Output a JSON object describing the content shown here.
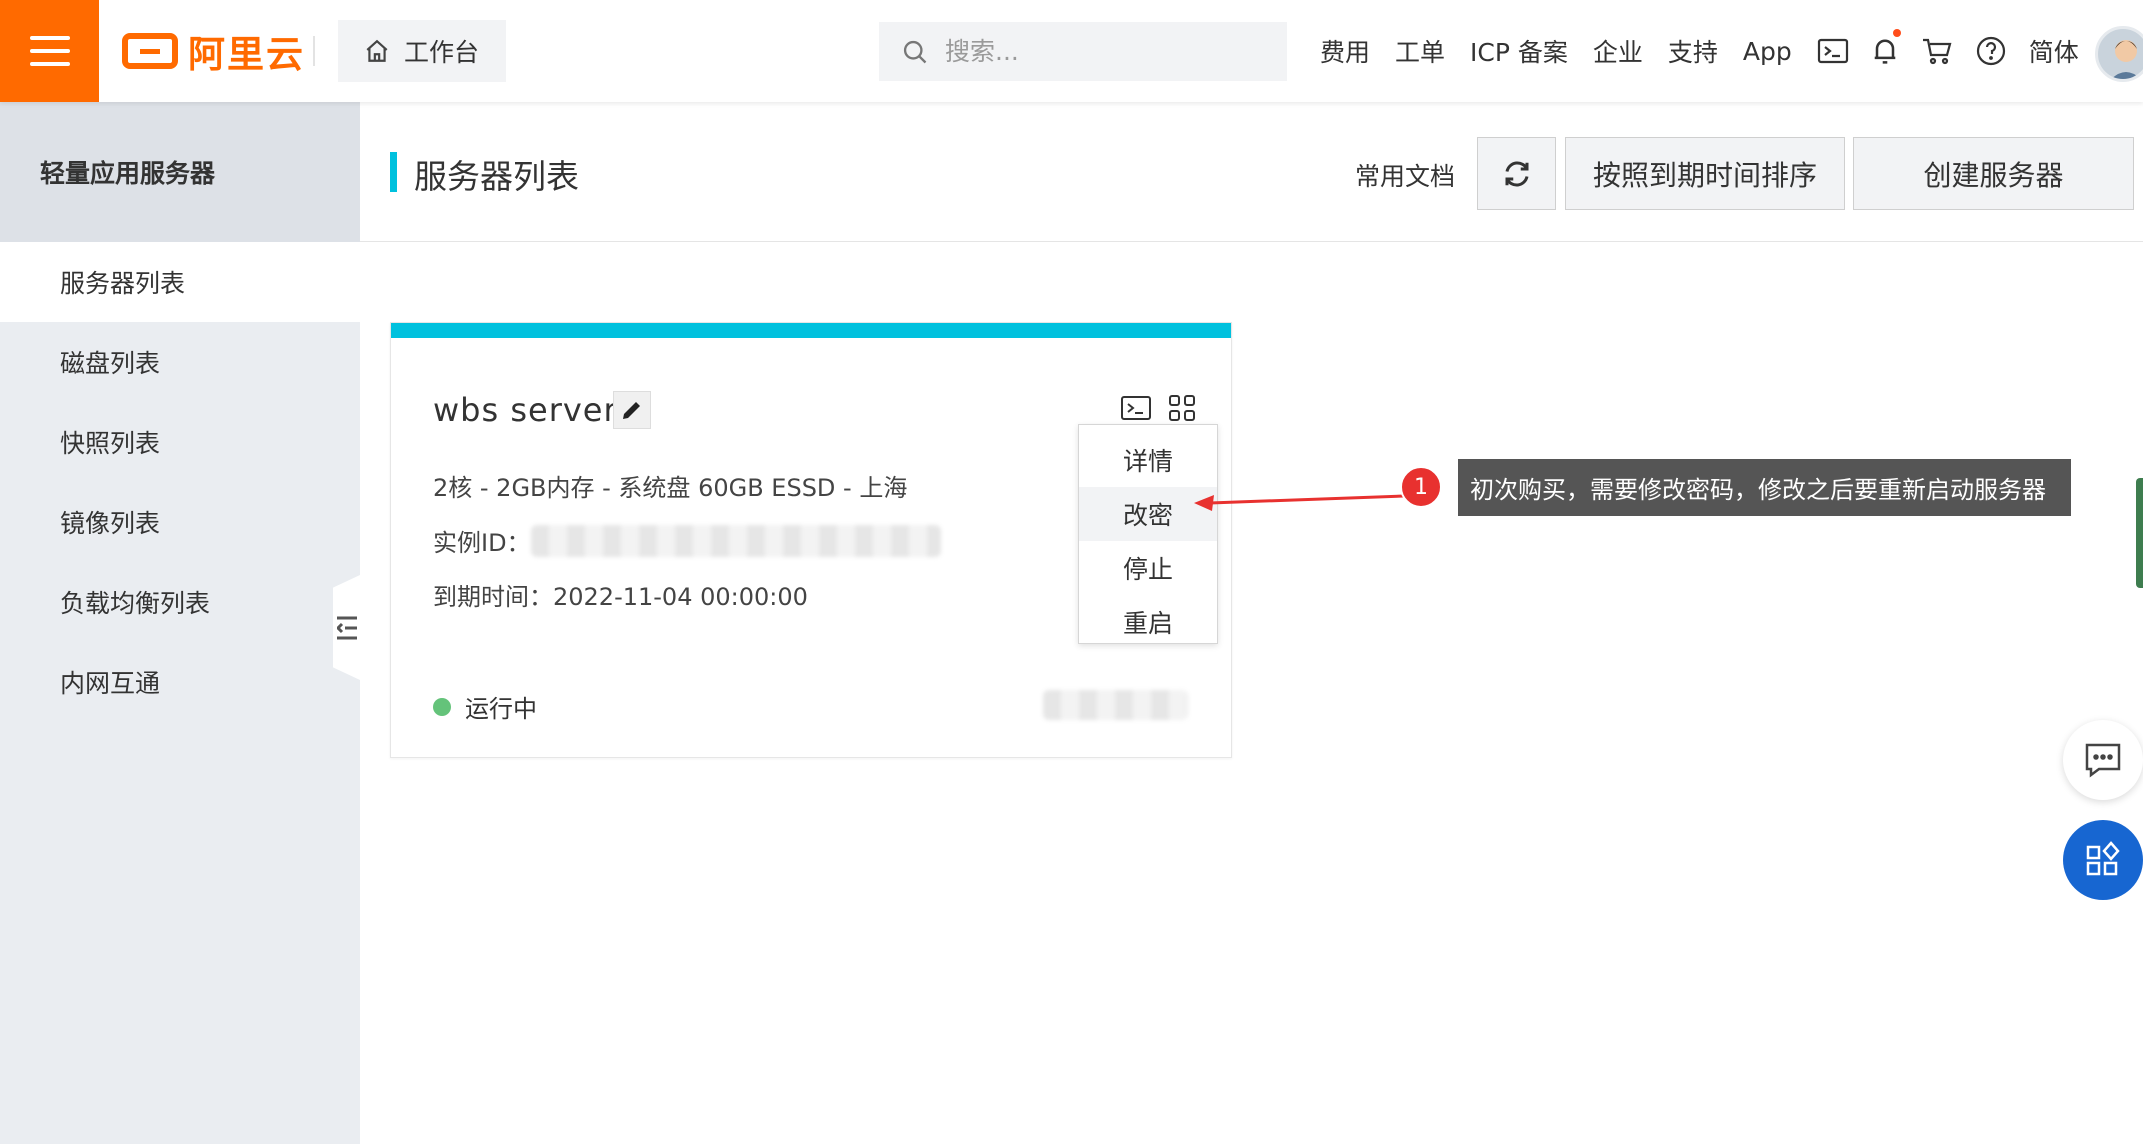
{
  "topbar": {
    "brand": "阿里云",
    "workbench": "工作台",
    "search_placeholder": "搜索...",
    "nav": [
      "费用",
      "工单",
      "ICP 备案",
      "企业",
      "支持",
      "App"
    ],
    "language": "简体",
    "accent_color": "#ff6a00"
  },
  "sidebar": {
    "title": "轻量应用服务器",
    "items": [
      {
        "label": "服务器列表",
        "active": true
      },
      {
        "label": "磁盘列表",
        "active": false
      },
      {
        "label": "快照列表",
        "active": false
      },
      {
        "label": "镜像列表",
        "active": false
      },
      {
        "label": "负载均衡列表",
        "active": false
      },
      {
        "label": "内网互通",
        "active": false
      }
    ]
  },
  "header": {
    "title": "服务器列表",
    "docs": "常用文档",
    "sort_button": "按照到期时间排序",
    "create_button": "创建服务器"
  },
  "card": {
    "name": "wbs server",
    "spec": "2核 - 2GB内存 - 系统盘 60GB ESSD - 上海",
    "instance_id_label": "实例ID：",
    "expire": "到期时间：2022-11-04 00:00:00",
    "status": "运行中",
    "status_color": "#64c37a"
  },
  "dropdown": {
    "items": [
      "详情",
      "改密",
      "停止",
      "重启"
    ],
    "highlighted": "改密"
  },
  "annotation": {
    "badge": "1",
    "text": "初次购买，需要修改密码，修改之后要重新启动服务器"
  }
}
